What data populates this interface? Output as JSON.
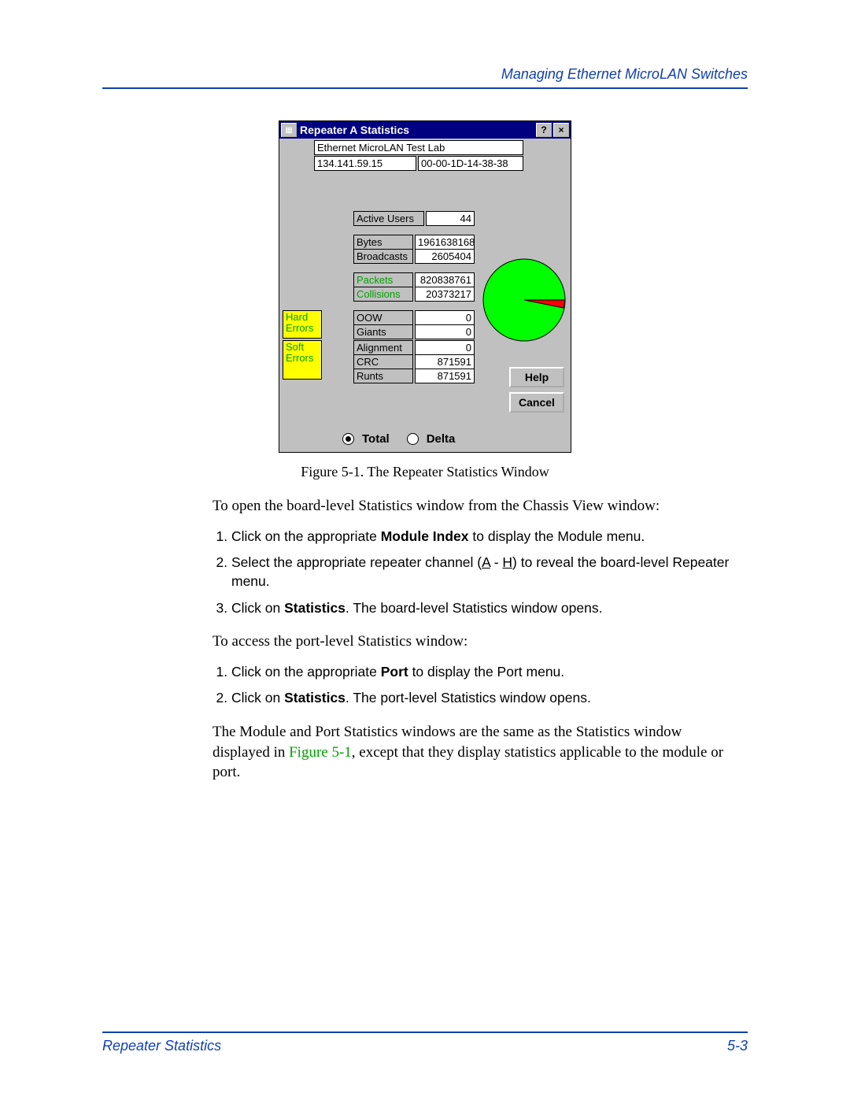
{
  "header": {
    "title": "Managing Ethernet MicroLAN Switches"
  },
  "window": {
    "title": "Repeater A Statistics",
    "device_name": "Ethernet MicroLAN Test Lab",
    "ip": "134.141.59.15",
    "mac": "00-00-1D-14-38-38",
    "stats": {
      "active_users_label": "Active Users",
      "active_users": "44",
      "bytes_label": "Bytes",
      "bytes": "1961638168",
      "broadcasts_label": "Broadcasts",
      "broadcasts": "2605404",
      "packets_label": "Packets",
      "packets": "820838761",
      "collisions_label": "Collisions",
      "collisions": "20373217",
      "hard_errors_label": "Hard\nErrors",
      "oow_label": "OOW",
      "oow": "0",
      "giants_label": "Giants",
      "giants": "0",
      "soft_errors_label": "Soft\nErrors",
      "alignment_label": "Alignment",
      "alignment": "0",
      "crc_label": "CRC",
      "crc": "871591",
      "runts_label": "Runts",
      "runts": "871591"
    },
    "radio": {
      "total": "Total",
      "delta": "Delta"
    },
    "buttons": {
      "help": "Help",
      "cancel": "Cancel"
    }
  },
  "figure_caption": "Figure 5-1. The Repeater Statistics Window",
  "text": {
    "intro1": "To open the board-level Statistics window from the Chassis View window:",
    "ol1": {
      "i1a": "Click on the appropriate ",
      "i1b": "Module Index",
      "i1c": " to display the Module menu.",
      "i2a": "Select the appropriate repeater channel (",
      "i2b": "A",
      "i2c": " - ",
      "i2d": "H",
      "i2e": ") to reveal the board-level Repeater menu.",
      "i3a": "Click on ",
      "i3b": "Statistics",
      "i3c": ". The board-level Statistics window opens."
    },
    "intro2": "To access the port-level Statistics window:",
    "ol2": {
      "i1a": "Click on the appropriate ",
      "i1b": "Port",
      "i1c": " to display the Port menu.",
      "i2a": "Click on ",
      "i2b": "Statistics",
      "i2c": ". The port-level Statistics window opens."
    },
    "para_a": "The Module and Port Statistics windows are the same as the Statistics window displayed in ",
    "para_ref": "Figure 5-1",
    "para_b": ", except that they display statistics applicable to the module or port."
  },
  "footer": {
    "left": "Repeater Statistics",
    "right": "5-3"
  },
  "chart_data": {
    "type": "pie",
    "title": "",
    "series": [
      {
        "name": "Packets",
        "value": 820838761,
        "color": "#00ff00"
      },
      {
        "name": "Collisions",
        "value": 20373217,
        "color": "#ff0000"
      }
    ]
  }
}
